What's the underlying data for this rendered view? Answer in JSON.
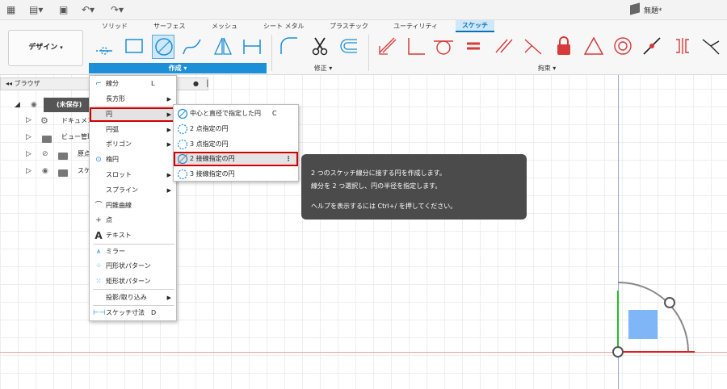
{
  "app": {
    "document_title": "無題*"
  },
  "ribbon": {
    "tabs": [
      {
        "label": "ソリッド"
      },
      {
        "label": "サーフェス"
      },
      {
        "label": "メッシュ"
      },
      {
        "label": "シート メタル"
      },
      {
        "label": "プラスチック"
      },
      {
        "label": "ユーティリティ"
      },
      {
        "label": "スケッチ",
        "active": true
      }
    ],
    "workspace_label": "デザイン",
    "sections": {
      "create": "作成",
      "modify": "修正",
      "constrain": "拘束"
    },
    "accent_color": "#1c8fd6",
    "constraint_color": "#d63a3a"
  },
  "browser": {
    "title": "ブラウザ",
    "items": [
      {
        "label": "(未保存)"
      },
      {
        "label": "ドキュメント"
      },
      {
        "label": "ビュー管理"
      },
      {
        "label": "原点"
      },
      {
        "label": "スケッチ"
      }
    ]
  },
  "create_menu": {
    "items": [
      {
        "label": "線分",
        "shortcut": "L",
        "icon": "line-icon"
      },
      {
        "label": "長方形",
        "submenu": true,
        "icon": "rectangle-icon"
      },
      {
        "label": "円",
        "submenu": true,
        "highlighted": true,
        "icon": "circle-icon"
      },
      {
        "label": "円弧",
        "submenu": true,
        "icon": "arc-icon"
      },
      {
        "label": "ポリゴン",
        "submenu": true,
        "icon": "polygon-icon"
      },
      {
        "label": "楕円",
        "icon": "ellipse-icon"
      },
      {
        "label": "スロット",
        "submenu": true,
        "icon": "slot-icon"
      },
      {
        "label": "スプライン",
        "submenu": true,
        "icon": "spline-icon"
      },
      {
        "label": "円錐曲線",
        "icon": "conic-icon"
      },
      {
        "label": "点",
        "icon": "point-icon"
      },
      {
        "label": "テキスト",
        "icon": "text-icon"
      },
      {
        "label": "ミラー",
        "icon": "mirror-icon"
      },
      {
        "label": "円形状パターン",
        "icon": "circular-pattern-icon"
      },
      {
        "label": "矩形状パターン",
        "icon": "rectangular-pattern-icon"
      },
      {
        "label": "投影/取り込み",
        "submenu": true,
        "icon": ""
      },
      {
        "label": "スケッチ寸法",
        "shortcut": "D",
        "icon": "dimension-icon"
      }
    ]
  },
  "circle_submenu": {
    "items": [
      {
        "label": "中心と直径で指定した円",
        "shortcut": "C"
      },
      {
        "label": "2 点指定の円",
        "shortcut": ""
      },
      {
        "label": "3 点指定の円",
        "shortcut": ""
      },
      {
        "label": "2 接線指定の円",
        "shortcut": "",
        "highlighted": true
      },
      {
        "label": "3 接線指定の円",
        "shortcut": ""
      }
    ]
  },
  "tooltip": {
    "line1": "2 つのスケッチ線分に接する円を作成します。",
    "line2": "線分を 2 つ選択し、円の半径を指定します。",
    "line3": "ヘルプを表示するには Ctrl+/ を押してください。"
  }
}
